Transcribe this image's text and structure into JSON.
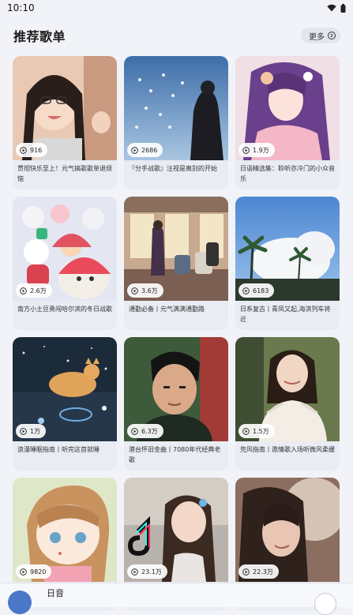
{
  "status": {
    "time": "10:10"
  },
  "section": {
    "title": "推荐歌单",
    "more_label": "更多"
  },
  "playlists": [
    {
      "plays": "916",
      "title": "贯彻快乐至上！元气搞歌歌单退烦恼"
    },
    {
      "plays": "2686",
      "title": "『分手战歌』注视是离别的开始"
    },
    {
      "plays": "1.9万",
      "title": "日语精选集：聆听亦冷门的小众音乐"
    },
    {
      "plays": "2.6万",
      "title": "南方小土豆勇闯哈尔滨的冬日战歌"
    },
    {
      "plays": "3.6万",
      "title": "通勤必备丨元气满满通勤路"
    },
    {
      "plays": "6183",
      "title": "日系复古丨青凤又起,海滨列车将近"
    },
    {
      "plays": "1万",
      "title": "浪漫睡眠指南丨听完这首就睡"
    },
    {
      "plays": "6.3万",
      "title": "港台怀旧金曲丨7080年代经典老歌"
    },
    {
      "plays": "1.5万",
      "title": "兜风指南丨邀情歌入场听微风柔缓"
    },
    {
      "plays": "9820",
      "title": ""
    },
    {
      "plays": "23.1万",
      "title": ""
    },
    {
      "plays": "22.3万",
      "title": ""
    }
  ],
  "mini_player": {
    "title": "日音"
  }
}
